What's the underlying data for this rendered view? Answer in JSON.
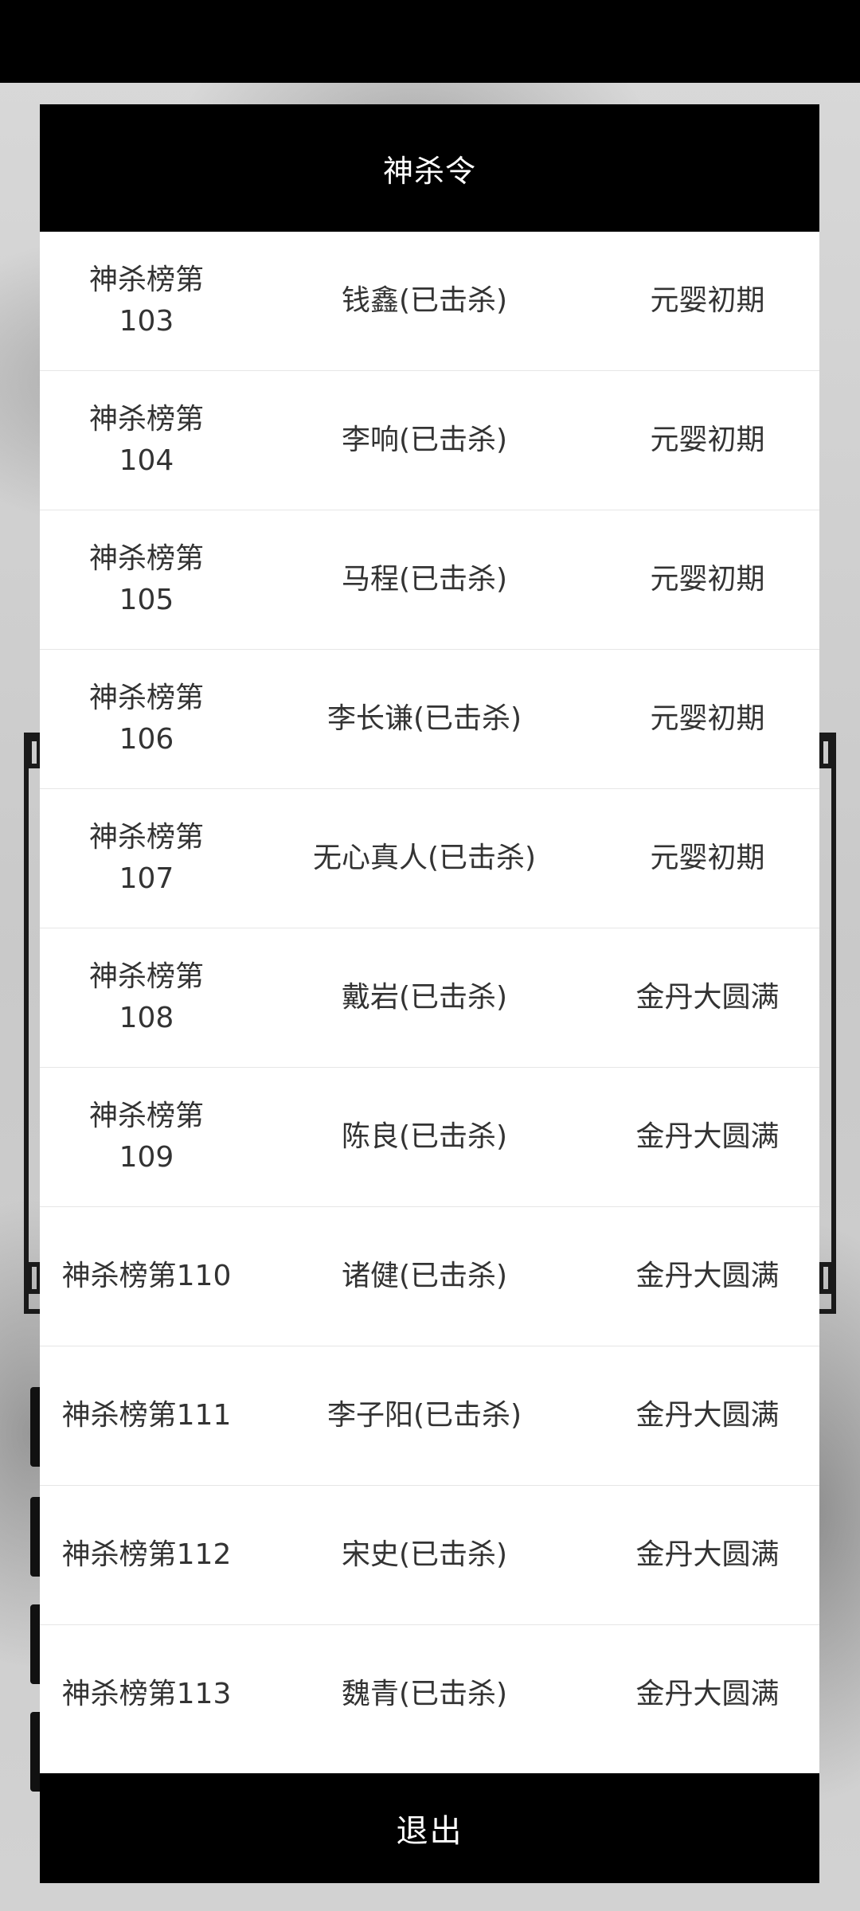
{
  "dialog": {
    "title": "神杀令",
    "exit_label": "退出"
  },
  "rows": [
    {
      "rank": "神杀榜第\n103",
      "name": "钱鑫(已击杀)",
      "realm": "元婴初期"
    },
    {
      "rank": "神杀榜第\n104",
      "name": "李响(已击杀)",
      "realm": "元婴初期"
    },
    {
      "rank": "神杀榜第\n105",
      "name": "马程(已击杀)",
      "realm": "元婴初期"
    },
    {
      "rank": "神杀榜第\n106",
      "name": "李长谦(已击杀)",
      "realm": "元婴初期"
    },
    {
      "rank": "神杀榜第\n107",
      "name": "无心真人(已击杀)",
      "realm": "元婴初期"
    },
    {
      "rank": "神杀榜第\n108",
      "name": "戴岩(已击杀)",
      "realm": "金丹大圆满"
    },
    {
      "rank": "神杀榜第\n109",
      "name": "陈良(已击杀)",
      "realm": "金丹大圆满"
    },
    {
      "rank": "神杀榜第110",
      "name": "诸健(已击杀)",
      "realm": "金丹大圆满"
    },
    {
      "rank": "神杀榜第111",
      "name": "李子阳(已击杀)",
      "realm": "金丹大圆满"
    },
    {
      "rank": "神杀榜第112",
      "name": "宋史(已击杀)",
      "realm": "金丹大圆满"
    },
    {
      "rank": "神杀榜第113",
      "name": "魏青(已击杀)",
      "realm": "金丹大圆满"
    }
  ]
}
